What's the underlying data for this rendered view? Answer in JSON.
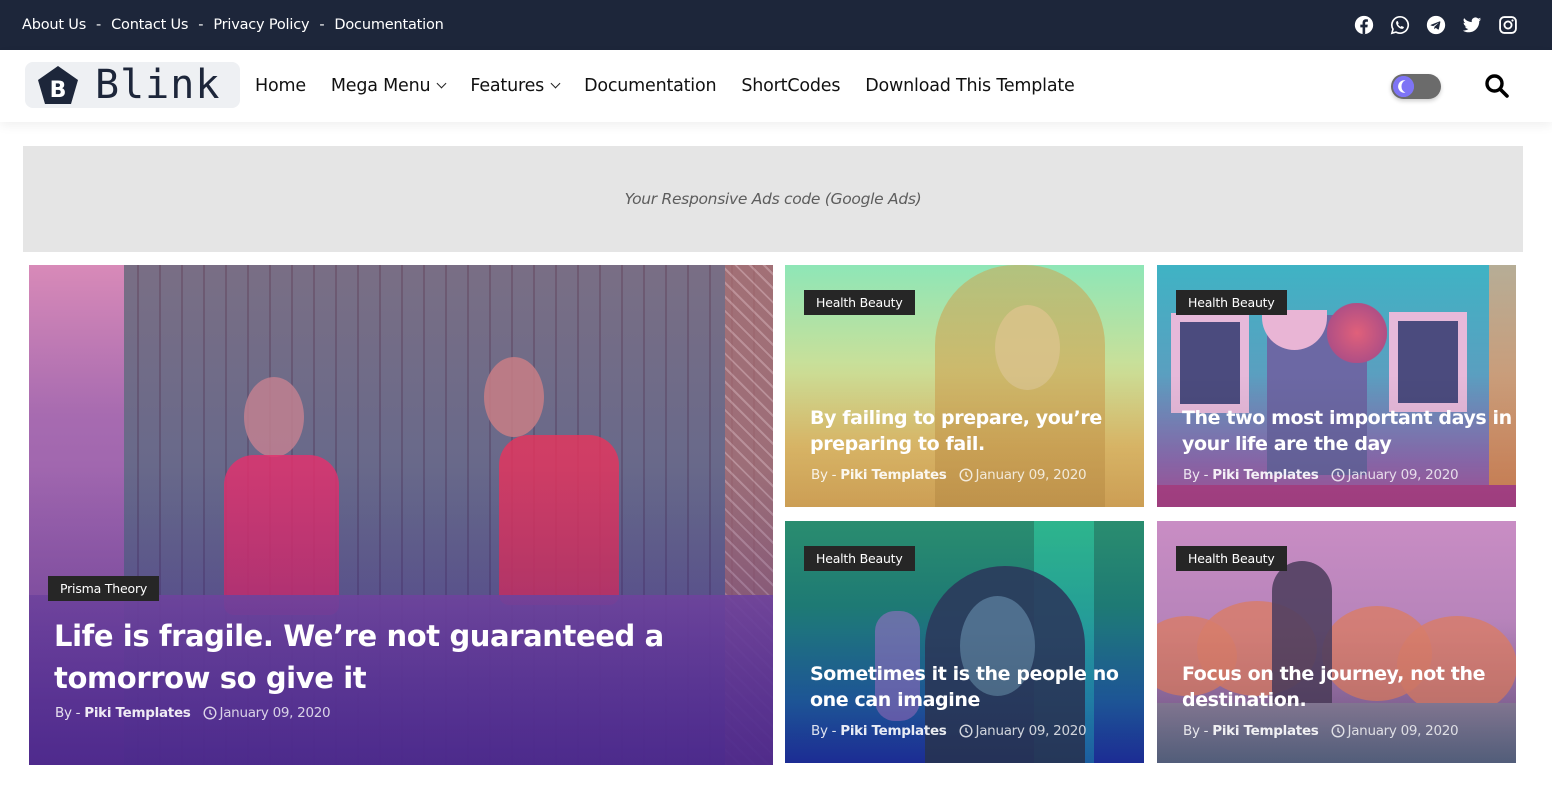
{
  "topbar": {
    "links": [
      "About Us",
      "Contact Us",
      "Privacy Policy",
      "Documentation"
    ],
    "separator": "-",
    "socials": [
      "facebook-icon",
      "whatsapp-icon",
      "telegram-icon",
      "twitter-icon",
      "instagram-icon"
    ],
    "background": "#1d263a"
  },
  "header": {
    "logo_letter": "B",
    "logo_text": "Blink",
    "nav": [
      {
        "label": "Home",
        "has_dropdown": false
      },
      {
        "label": "Mega Menu",
        "has_dropdown": true
      },
      {
        "label": "Features",
        "has_dropdown": true
      },
      {
        "label": "Documentation",
        "has_dropdown": false
      },
      {
        "label": "ShortCodes",
        "has_dropdown": false
      },
      {
        "label": "Download This Template",
        "has_dropdown": false
      }
    ],
    "dark_mode_toggle": {
      "icon": "moon-icon",
      "accent": "#7e74f5"
    },
    "search_icon": "search-icon"
  },
  "ad": {
    "text": "Your Responsive Ads code (Google Ads)"
  },
  "posts": [
    {
      "category": "Prisma Theory",
      "title": "Life is fragile. We’re not guaranteed a tomorrow so give it",
      "by": "By -",
      "author": "Piki Templates",
      "date": "January 09, 2020"
    },
    {
      "category": "Health Beauty",
      "title": "By failing to prepare, you’re preparing to fail.",
      "by": "By -",
      "author": "Piki Templates",
      "date": "January 09, 2020"
    },
    {
      "category": "Health Beauty",
      "title": "The two most important days in your life are the day",
      "by": "By -",
      "author": "Piki Templates",
      "date": "January 09, 2020"
    },
    {
      "category": "Health Beauty",
      "title": "Sometimes it is the people no one can imagine",
      "by": "By -",
      "author": "Piki Templates",
      "date": "January 09, 2020"
    },
    {
      "category": "Health Beauty",
      "title": "Focus on the journey, not the destination.",
      "by": "By -",
      "author": "Piki Templates",
      "date": "January 09, 2020"
    }
  ]
}
